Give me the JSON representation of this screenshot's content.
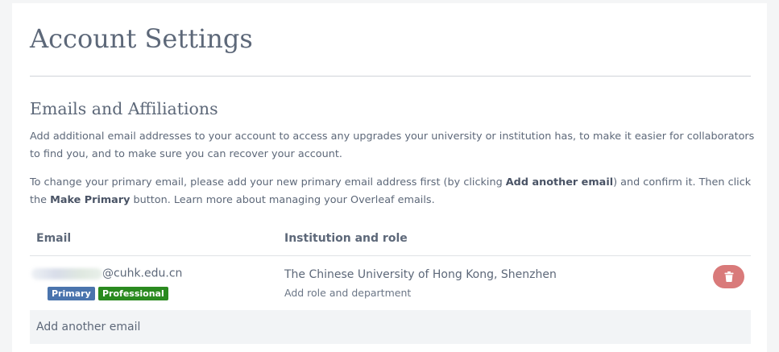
{
  "page": {
    "title": "Account Settings"
  },
  "section": {
    "title": "Emails and Affiliations",
    "description": "Add additional email addresses to your account to access any upgrades your university or institution has, to make it easier for collaborators to find you, and to make sure you can recover your account.",
    "instructions": {
      "part1": "To change your primary email, please add your new primary email address first (by clicking ",
      "bold_add": "Add another email",
      "part2": ") and confirm it. Then click the ",
      "bold_make": "Make Primary",
      "part3": " button. ",
      "link": "Learn more about managing your Overleaf emails",
      "part4": "."
    }
  },
  "table": {
    "headers": {
      "email": "Email",
      "institution": "Institution and role"
    },
    "rows": [
      {
        "email_domain": "@cuhk.edu.cn",
        "badges": {
          "primary": "Primary",
          "professional": "Professional"
        },
        "institution": "The Chinese University of Hong Kong, Shenzhen",
        "role_link": "Add role and department",
        "delete_icon": "trash-icon"
      }
    ],
    "add_email": "Add another email"
  },
  "colors": {
    "primary_badge": "#4a74ad",
    "professional_badge": "#2a8a1f",
    "delete_button": "#d97a7a",
    "text": "#5d6879"
  }
}
